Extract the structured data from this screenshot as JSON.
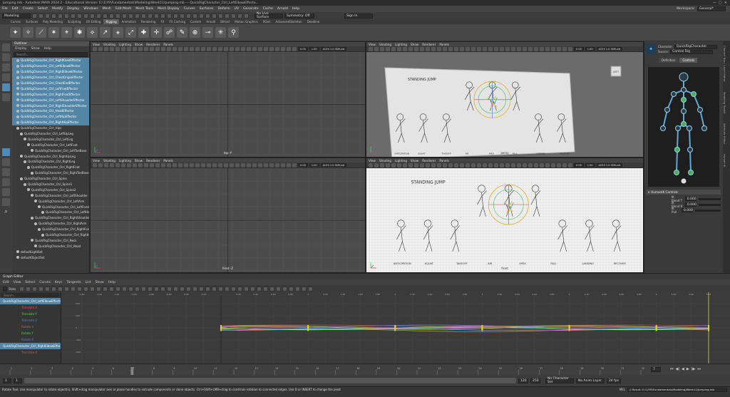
{
  "window": {
    "title": "Jumping.mb - Autodesk MAYA 2024.2 - Educational Version: E:\\1\\YR\\Fundamentals\\Modeling\\Week11\\Jumping.mb --- QuickRigCharacter_Ctrl_LeftElbowEffecto..."
  },
  "menubar": [
    "File",
    "Edit",
    "Create",
    "Select",
    "Modify",
    "Display",
    "Windows",
    "Mesh",
    "Edit Mesh",
    "Mesh Tools",
    "Mesh Display",
    "Curves",
    "Surfaces",
    "Deform",
    "UV",
    "Generate",
    "Cache",
    "Arnold",
    "Help"
  ],
  "workspace": {
    "label": "Workspace:",
    "value": "General*"
  },
  "statusline": {
    "mode": "Modeling",
    "live_surface": "No Live Surface",
    "symmetry": "Symmetry: Off",
    "sign_in": "Sign In"
  },
  "shelf_tabs": [
    "Curves",
    "Surfaces",
    "Poly Modeling",
    "Sculpting",
    "UV Editing",
    "Rigging",
    "Animation",
    "Rendering",
    "FX",
    "FX Caching",
    "Custom",
    "Arnold",
    "Bifrost",
    "Motion Graphics",
    "XGen",
    "AdvancedSkeleton",
    "Deadline"
  ],
  "shelf_active": "Rigging",
  "outliner": {
    "title": "Outliner",
    "menu": [
      "Display",
      "Show",
      "Help"
    ],
    "search": "Search...",
    "items": [
      {
        "label": "QuickRigCharacter_Ctrl_RightKneeEffector",
        "sel": true,
        "indent": 0
      },
      {
        "label": "QuickRigCharacter_Ctrl_LeftElbowEffector",
        "sel": true,
        "indent": 0
      },
      {
        "label": "QuickRigCharacter_Ctrl_RightElbowEffector",
        "sel": true,
        "indent": 0
      },
      {
        "label": "QuickRigCharacter_Ctrl_ChestOriginEffector",
        "sel": true,
        "indent": 0
      },
      {
        "label": "QuickRigCharacter_Ctrl_ChestEndEffector",
        "sel": true,
        "indent": 0
      },
      {
        "label": "QuickRigCharacter_Ctrl_LeftFootEffector",
        "sel": true,
        "indent": 0
      },
      {
        "label": "QuickRigCharacter_Ctrl_RightFootEffector",
        "sel": true,
        "indent": 0
      },
      {
        "label": "QuickRigCharacter_Ctrl_LeftShoulderEffector",
        "sel": true,
        "indent": 0
      },
      {
        "label": "QuickRigCharacter_Ctrl_RightShoulderEffector",
        "sel": true,
        "indent": 0
      },
      {
        "label": "QuickRigCharacter_Ctrl_HeadEffector",
        "sel": true,
        "indent": 0
      },
      {
        "label": "QuickRigCharacter_Ctrl_LeftHipEffector",
        "sel": true,
        "indent": 0
      },
      {
        "label": "QuickRigCharacter_Ctrl_RightHipEffector",
        "sel": true,
        "indent": 0
      },
      {
        "label": "QuickRigCharacter_Ctrl_Hips",
        "sel": false,
        "indent": 0
      },
      {
        "label": "QuickRigCharacter_Ctrl_LeftUpLeg",
        "sel": false,
        "indent": 1
      },
      {
        "label": "QuickRigCharacter_Ctrl_LeftLeg",
        "sel": false,
        "indent": 2
      },
      {
        "label": "QuickRigCharacter_Ctrl_LeftFoot",
        "sel": false,
        "indent": 3
      },
      {
        "label": "QuickRigCharacter_Ctrl_LeftToeBase",
        "sel": false,
        "indent": 4
      },
      {
        "label": "QuickRigCharacter_Ctrl_RightUpLeg",
        "sel": false,
        "indent": 1
      },
      {
        "label": "QuickRigCharacter_Ctrl_RightLeg",
        "sel": false,
        "indent": 2
      },
      {
        "label": "QuickRigCharacter_Ctrl_RightFoot",
        "sel": false,
        "indent": 3
      },
      {
        "label": "QuickRigCharacter_Ctrl_RightToeBase",
        "sel": false,
        "indent": 4
      },
      {
        "label": "QuickRigCharacter_Ctrl_Spine",
        "sel": false,
        "indent": 1
      },
      {
        "label": "QuickRigCharacter_Ctrl_Spine1",
        "sel": false,
        "indent": 2
      },
      {
        "label": "QuickRigCharacter_Ctrl_Spine2",
        "sel": false,
        "indent": 3
      },
      {
        "label": "QuickRigCharacter_Ctrl_LeftShoulder",
        "sel": false,
        "indent": 4
      },
      {
        "label": "QuickRigCharacter_Ctrl_LeftArm",
        "sel": false,
        "indent": 5
      },
      {
        "label": "QuickRigCharacter_Ctrl_LeftForeArm",
        "sel": false,
        "indent": 6
      },
      {
        "label": "QuickRigCharacter_Ctrl_LeftHand",
        "sel": false,
        "indent": 7
      },
      {
        "label": "QuickRigCharacter_Ctrl_RightShoulder",
        "sel": false,
        "indent": 4
      },
      {
        "label": "QuickRigCharacter_Ctrl_RightArm",
        "sel": false,
        "indent": 5
      },
      {
        "label": "QuickRigCharacter_Ctrl_RightForeArm",
        "sel": false,
        "indent": 6
      },
      {
        "label": "QuickRigCharacter_Ctrl_RightHand",
        "sel": false,
        "indent": 7
      },
      {
        "label": "QuickRigCharacter_Ctrl_Neck",
        "sel": false,
        "indent": 4
      },
      {
        "label": "QuickRigCharacter_Ctrl_Head",
        "sel": false,
        "indent": 5
      },
      {
        "label": "defaultLightSet",
        "sel": false,
        "indent": 0
      },
      {
        "label": "defaultObjectSet",
        "sel": false,
        "indent": 0
      }
    ]
  },
  "viewport_menu": [
    "View",
    "Shading",
    "Lighting",
    "Show",
    "Renderer",
    "Panels"
  ],
  "viewport_fields": {
    "exposure": "0.00",
    "gamma": "1.00",
    "colorspace": "ACES 1.0 SDR-vid"
  },
  "viewports": [
    {
      "label": "top -Y"
    },
    {
      "label": "persp"
    },
    {
      "label": "front -Z"
    },
    {
      "label": "front"
    }
  ],
  "viewcube": "LEFT",
  "sketch": {
    "title": "STANDING JUMP",
    "captions": [
      "ANTICIPATION",
      "SQUAT",
      "TAKEOFF",
      "AIR",
      "APEX",
      "FALL",
      "LANDING",
      "RECOVER"
    ]
  },
  "right_panel": {
    "character_label": "Character:",
    "character": "QuickRigCharacter",
    "source_label": "Source:",
    "source": "Control Rig",
    "tabs": [
      "Definition",
      "Controls"
    ],
    "active_tab": "Controls",
    "section": "HumanIK Controls",
    "blends": [
      {
        "label": "IK Blend T",
        "value": "0.000"
      },
      {
        "label": "IK Blend R",
        "value": "0.000"
      },
      {
        "label": "IK Pull",
        "value": "0.000"
      }
    ]
  },
  "side_tabs": [
    "Channel Box / Layer Editor",
    "Modeling Toolkit",
    "Attribute Editor",
    "Human IK"
  ],
  "graph_editor": {
    "title": "Graph Editor",
    "menu": [
      "Edit",
      "View",
      "Select",
      "Curves",
      "Keys",
      "Tangents",
      "List",
      "Show",
      "Help"
    ],
    "stats": "Stats",
    "search": "Search...",
    "curves": [
      {
        "label": "QuickRigCharacter_Ctrl_LeftElbowEffector",
        "sel": true
      },
      {
        "label": "Translate X",
        "color": "#e05050"
      },
      {
        "label": "Translate Y",
        "color": "#50d050"
      },
      {
        "label": "Translate Z",
        "color": "#5080e0"
      },
      {
        "label": "Rotate X",
        "color": "#e05050"
      },
      {
        "label": "Rotate Y",
        "color": "#50d050"
      },
      {
        "label": "Rotate Z",
        "color": "#5080e0"
      },
      {
        "label": "QuickRigCharacter_Ctrl_RightElbowEffector",
        "sel": true
      },
      {
        "label": "Translate X",
        "color": "#e05050"
      }
    ],
    "y_ticks": [
      "200",
      "100",
      "0",
      "-100",
      "-200"
    ],
    "x_ticks": [
      "-1.60",
      "-1.40",
      "-1.20",
      "-1.00",
      "-0.80",
      "-0.60",
      "-0.40",
      "-0.20",
      "0",
      "0.20",
      "0.40",
      "0.60",
      "0.80",
      "1",
      "1.20",
      "1.40",
      "1.60",
      "1.80",
      "2",
      "2.20",
      "2.40",
      "2.60",
      "2.80",
      "3",
      "3.20",
      "3.40",
      "3.60",
      "3.80",
      "4",
      "4.20",
      "4.40",
      "4.60",
      "4.80",
      "5",
      "5.20",
      "5.40",
      "5.60"
    ],
    "keyframes": [
      0,
      1,
      2,
      3,
      4,
      5,
      5.6
    ]
  },
  "time_slider": {
    "ticks": [
      "1",
      "2",
      "3",
      "4",
      "5",
      "6",
      "7",
      "8",
      "9",
      "10",
      "11",
      "12",
      "13",
      "14",
      "15",
      "16",
      "17",
      "18",
      "19",
      "20",
      "21",
      "22",
      "23",
      "24",
      "25",
      "26",
      "27",
      "28",
      "29",
      "30",
      "31",
      "32"
    ],
    "current": "7",
    "start": "1",
    "end": "120",
    "range_start": "1",
    "range_end": "250",
    "fps": "24 fps",
    "no_char": "No Character Set",
    "no_anim_layer": "No Anim Layer"
  },
  "command_line": {
    "lang": "MEL",
    "result": "// Result: E:/1/YR/Fundamentals/Modeling/Week11/Jumping.mb"
  },
  "help_line": "Rotate Tool: Use manipulator to rotate object(s). Shift+drag manipulator axis or plane handles to extrude components or clone objects. Ctrl+Shift+LMB+drag to constrain rotation to connected edges. Use D or INSERT to change the pivot"
}
